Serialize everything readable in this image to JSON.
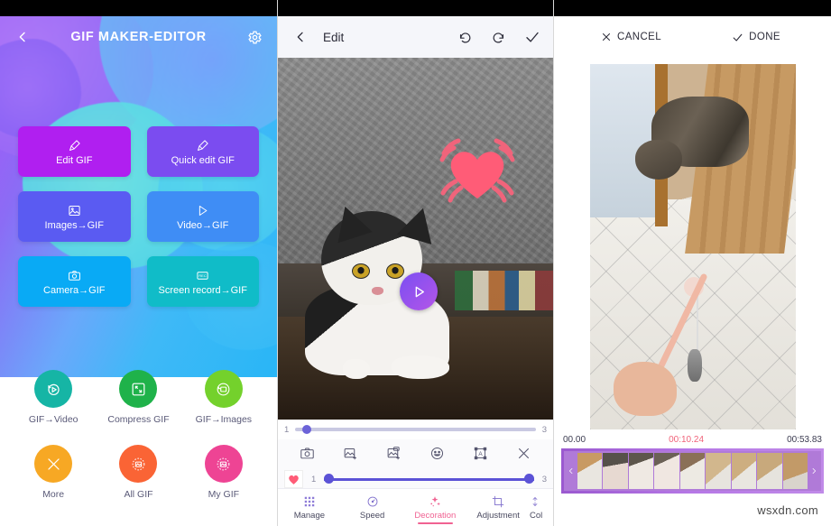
{
  "left": {
    "header": {
      "back_icon": "chevron-left-icon",
      "title": "GIF MAKER-EDITOR",
      "settings_icon": "gear-icon"
    },
    "tiles": [
      {
        "label": "Edit GIF",
        "icon": "brush-icon",
        "color": "#b01ff0"
      },
      {
        "label": "Quick edit GIF",
        "icon": "brush-icon",
        "color": "#7b4cf0"
      },
      {
        "label": "Images→GIF",
        "icon": "image-icon",
        "color": "#5a5bf2"
      },
      {
        "label": "Video→GIF",
        "icon": "play-icon",
        "color": "#3f8df5"
      },
      {
        "label": "Camera→GIF",
        "icon": "camera-icon",
        "color": "#09aaf5"
      },
      {
        "label": "Screen record→GIF",
        "icon": "rec-icon",
        "color": "#10bcc8"
      }
    ],
    "circles": [
      {
        "label": "GIF→Video",
        "icon": "play-refresh-icon",
        "color": "#16b5a5"
      },
      {
        "label": "Compress GIF",
        "icon": "compress-icon",
        "color": "#1fb24a"
      },
      {
        "label": "GIF→Images",
        "icon": "image-refresh-icon",
        "color": "#74d12c"
      },
      {
        "label": "More",
        "icon": "tools-icon",
        "color": "#f7a824"
      },
      {
        "label": "All GIF",
        "icon": "gallery-icon",
        "color": "#fa6435"
      },
      {
        "label": "My GIF",
        "icon": "gallery-icon",
        "color": "#ee4494"
      }
    ]
  },
  "middle": {
    "header": {
      "back_icon": "chevron-left-icon",
      "title": "Edit",
      "undo_icon": "undo-icon",
      "redo_icon": "redo-icon",
      "confirm_icon": "check-icon"
    },
    "canvas": {
      "sticker": "heart-sticker",
      "play_overlay_icon": "play-icon"
    },
    "frame_slider": {
      "min_label": "1",
      "max_label": "3",
      "value": 1
    },
    "tools": [
      {
        "icon": "camera-icon",
        "name": "camera-tool"
      },
      {
        "icon": "add-image-icon",
        "name": "add-image-tool"
      },
      {
        "icon": "add-gif-icon",
        "name": "add-gif-tool"
      },
      {
        "icon": "emoji-icon",
        "name": "emoji-tool"
      },
      {
        "icon": "text-box-icon",
        "name": "text-tool"
      },
      {
        "icon": "close-icon",
        "name": "delete-tool"
      }
    ],
    "range_row": {
      "thumb_icon": "heart-thumbnail",
      "min_label": "1",
      "max_label": "3",
      "start": 1,
      "end": 3
    },
    "nav": [
      {
        "label": "Manage",
        "icon": "grid-icon",
        "active": false
      },
      {
        "label": "Speed",
        "icon": "speedometer-icon",
        "active": false
      },
      {
        "label": "Decoration",
        "icon": "sparkle-icon",
        "active": true
      },
      {
        "label": "Adjustment",
        "icon": "crop-icon",
        "active": false
      },
      {
        "label": "Col",
        "icon": "sliders-icon",
        "active": false
      }
    ],
    "accent_color": "#f06292"
  },
  "right": {
    "header": {
      "cancel_label": "CANCEL",
      "cancel_icon": "close-icon",
      "done_label": "DONE",
      "done_icon": "check-icon"
    },
    "timeline": {
      "start_time": "00.00",
      "current_time": "00:10.24",
      "end_time": "00:53.83",
      "frame_count": 9,
      "left_handle_icon": "chevron-left-icon",
      "right_handle_icon": "chevron-right-icon",
      "border_color": "#a766d8",
      "current_time_color": "#f0637a"
    },
    "watermark": "wsxdn.com"
  }
}
